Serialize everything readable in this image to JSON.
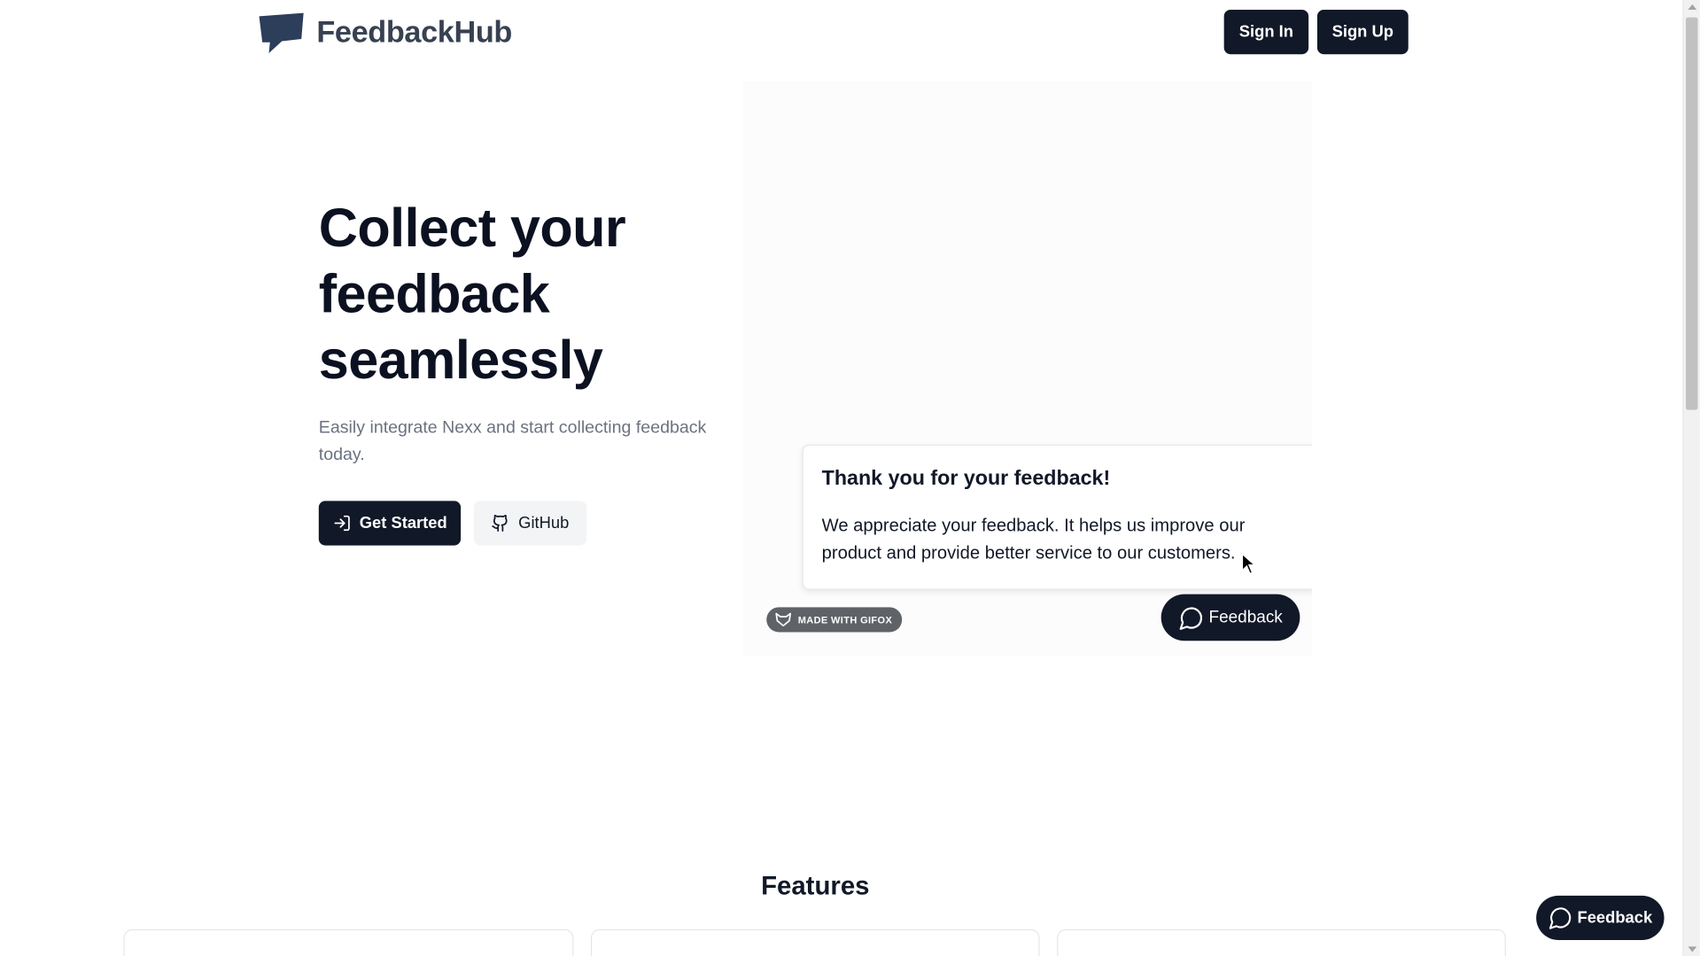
{
  "header": {
    "logo_text": "FeedbackHub",
    "sign_in_label": "Sign In",
    "sign_up_label": "Sign Up"
  },
  "hero": {
    "title": "Collect your feedback seamlessly",
    "subtitle": "Easily integrate Nexx and start collecting feedback today.",
    "get_started_label": "Get Started",
    "github_label": "GitHub"
  },
  "demo": {
    "toast_title": "Thank you for your feedback!",
    "toast_body": "We appreciate your feedback. It helps us improve our product and provide better service to our customers.",
    "badge_text": "MADE WITH GIFOX",
    "feedback_label": "Feedback"
  },
  "features": {
    "title": "Features"
  },
  "floating": {
    "feedback_label": "Feedback"
  },
  "colors": {
    "primary": "#111827",
    "muted_text": "#6b7280",
    "logo_blue": "#2c3e5a",
    "secondary_bg": "#f3f4f6"
  },
  "icons": {
    "logo": "speech-flag-icon",
    "get_started": "log-in-icon",
    "github": "github-icon",
    "feedback": "message-circle-icon",
    "badge": "fox-icon"
  }
}
